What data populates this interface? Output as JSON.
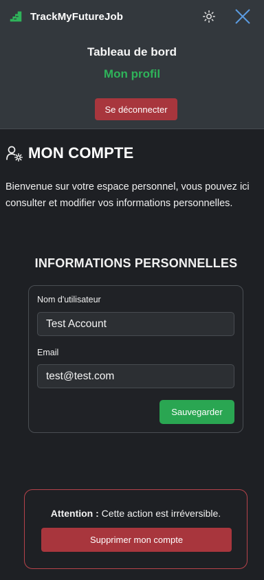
{
  "header": {
    "brand_name": "TrackMyFutureJob",
    "icons": {
      "logo": "shoe-logo-icon",
      "theme": "sun-icon",
      "close": "close-icon"
    },
    "nav": {
      "dashboard": "Tableau de bord",
      "profile": "Mon profil"
    },
    "logout_label": "Se déconnecter"
  },
  "account": {
    "title": "MON COMPTE",
    "icon": "user-settings-icon",
    "intro": "Bienvenue sur votre espace personnel, vous pouvez ici consulter et modifier vos informations personnelles."
  },
  "personal_info": {
    "title": "INFORMATIONS PERSONNELLES",
    "username_label": "Nom d'utilisateur",
    "username_value": "Test Account",
    "email_label": "Email",
    "email_value": "test@test.com",
    "save_label": "Sauvegarder"
  },
  "danger_zone": {
    "warning_bold": "Attention :",
    "warning_text": "Cette action est irréversible.",
    "delete_label": "Supprimer mon compte"
  },
  "colors": {
    "accent_green": "#2fb35a",
    "danger_red": "#a8363d",
    "header_bg": "#33383d",
    "page_bg": "#1e2024"
  }
}
